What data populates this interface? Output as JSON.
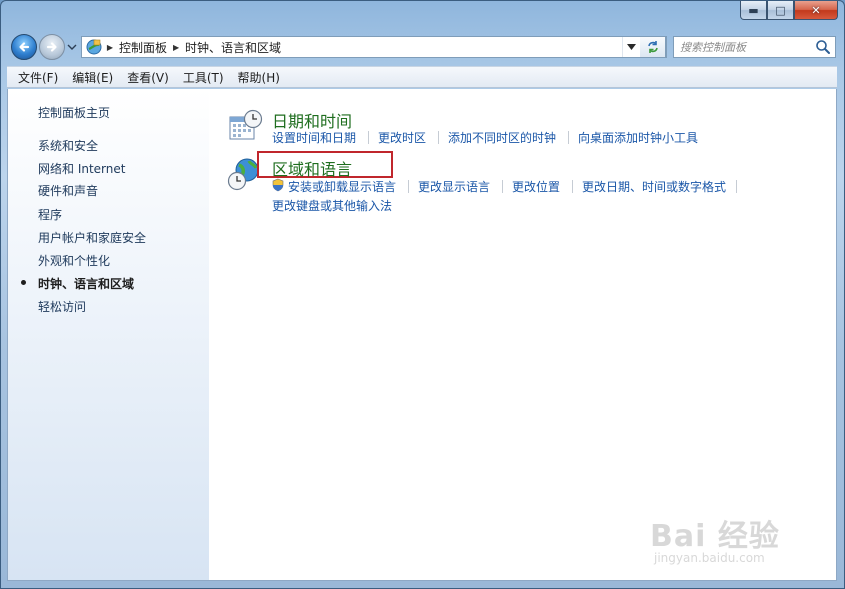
{
  "window": {
    "caption_buttons": {
      "minimize": "▬",
      "maximize": "□",
      "close": "✕"
    }
  },
  "address": {
    "breadcrumbs": [
      "控制面板",
      "时钟、语言和区域"
    ]
  },
  "search": {
    "placeholder": "搜索控制面板"
  },
  "menu": [
    "文件(F)",
    "编辑(E)",
    "查看(V)",
    "工具(T)",
    "帮助(H)"
  ],
  "sidebar": {
    "items": [
      {
        "label": "控制面板主页",
        "current": false
      },
      {
        "label": "系统和安全",
        "current": false
      },
      {
        "label": "网络和 Internet",
        "current": false
      },
      {
        "label": "硬件和声音",
        "current": false
      },
      {
        "label": "程序",
        "current": false
      },
      {
        "label": "用户帐户和家庭安全",
        "current": false
      },
      {
        "label": "外观和个性化",
        "current": false
      },
      {
        "label": "时钟、语言和区域",
        "current": true
      },
      {
        "label": "轻松访问",
        "current": false
      }
    ]
  },
  "categories": [
    {
      "title": "日期和时间",
      "icon": "calendar-clock-icon",
      "links": [
        "设置时间和日期",
        "更改时区",
        "添加不同时区的时钟",
        "向桌面添加时钟小工具"
      ]
    },
    {
      "title": "区域和语言",
      "icon": "globe-clock-icon",
      "links": [
        "安装或卸载显示语言",
        "更改显示语言",
        "更改位置",
        "更改日期、时间或数字格式",
        "更改键盘或其他输入法"
      ],
      "highlighted": true
    }
  ],
  "watermark": {
    "text": "Bai 经验",
    "url": "jingyan.baidu.com"
  },
  "colors": {
    "link": "#1b57a8",
    "category_title": "#1f6e1f",
    "highlight": "#c0262c"
  }
}
